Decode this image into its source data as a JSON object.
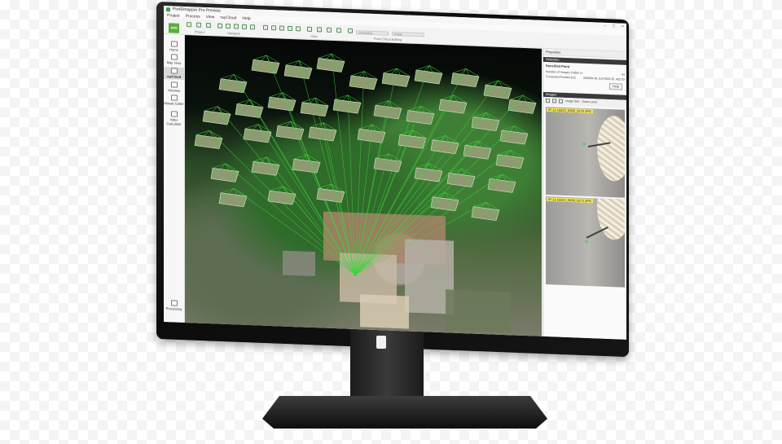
{
  "window": {
    "title": "Pix4Dmapper Pro Preview",
    "controls": [
      "–",
      "□",
      "×"
    ]
  },
  "menu": [
    "Project",
    "Process",
    "View",
    "rayCloud",
    "Help"
  ],
  "toolbar": {
    "groups": [
      "Project",
      "Navigate",
      "View"
    ],
    "field_1": "Unsatisfied",
    "field_2": "Image",
    "field_3": "Point Cloud Editing"
  },
  "sidebar": {
    "logo_text": "ANS",
    "items": [
      {
        "label": "Home",
        "icon": "home-icon"
      },
      {
        "label": "Map View",
        "icon": "map-icon"
      },
      {
        "label": "rayCloud",
        "icon": "raycloud-icon",
        "active": true
      },
      {
        "label": "Volumes",
        "icon": "volumes-icon"
      },
      {
        "label": "Mosaic Editor",
        "icon": "mosaic-icon"
      },
      {
        "label": "Index Calculator",
        "icon": "index-icon"
      },
      {
        "label": "Processing",
        "icon": "processing-icon"
      }
    ]
  },
  "properties": {
    "header": "Properties",
    "selection_section": "Selection",
    "selection_title": "Densified Point",
    "rows": [
      {
        "label": "Number of Images Visible in:",
        "value": "44"
      },
      {
        "label": "Computed Position [m]:",
        "value": "269699.48, 5147826.35, 402.93"
      }
    ],
    "button": "Help",
    "images_section": "Images",
    "image_size_label": "Image Size",
    "zoom_label": "Zoom Level",
    "thumbnails": [
      {
        "label": "IP-11-16323_0068_0270.JPG"
      },
      {
        "label": "IP-11-16323_0068_0272.JPG"
      }
    ]
  },
  "colors": {
    "camera_frustum": "#3fd33a",
    "accent_green": "#5aae3c",
    "highlight_label": "#f1e45a"
  }
}
